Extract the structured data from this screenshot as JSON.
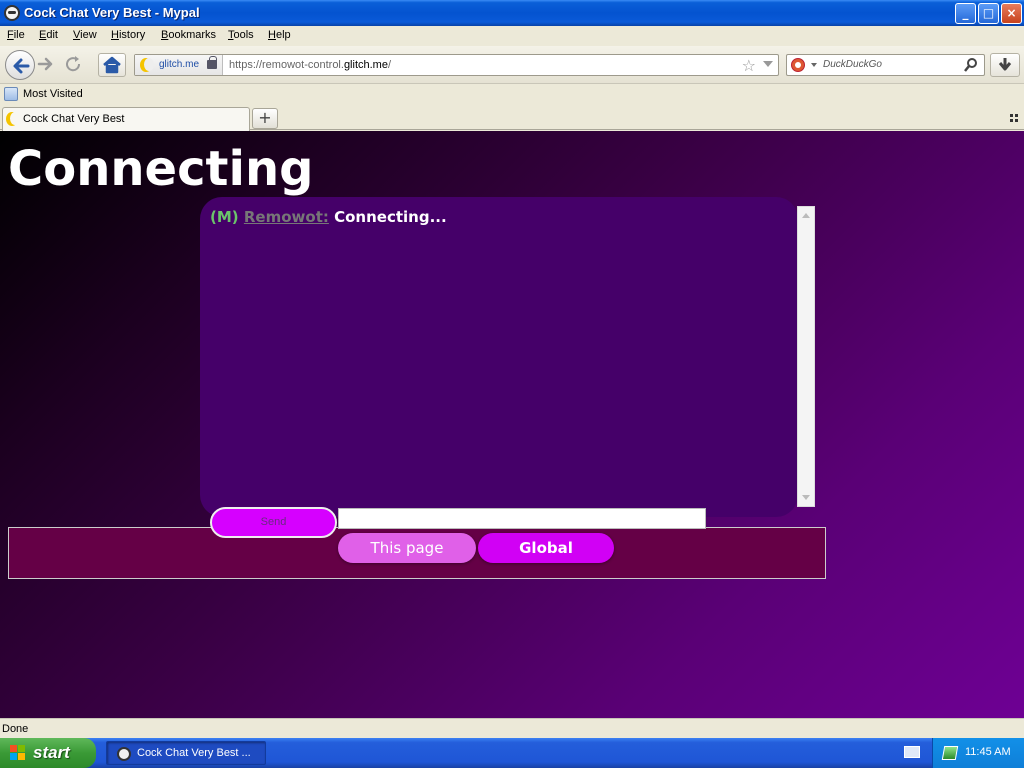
{
  "window": {
    "title": "Cock Chat Very Best - Mypal",
    "controls": {
      "minimize": "_",
      "maximize": "□",
      "close": "×"
    }
  },
  "menu": {
    "items": [
      {
        "label": "File",
        "accel": "F",
        "rest": "ile"
      },
      {
        "label": "Edit",
        "accel": "E",
        "rest": "dit"
      },
      {
        "label": "View",
        "accel": "V",
        "rest": "iew"
      },
      {
        "label": "History",
        "accel": "H",
        "rest": "istory"
      },
      {
        "label": "Bookmarks",
        "accel": "B",
        "rest": "ookmarks"
      },
      {
        "label": "Tools",
        "accel": "T",
        "rest": "ools"
      },
      {
        "label": "Help",
        "accel": "H",
        "rest": "elp"
      }
    ]
  },
  "navbar": {
    "identity_domain": "glitch.me",
    "url_prefix": "https://remowot-control.",
    "url_domain": "glitch.me",
    "url_suffix": "/",
    "search_placeholder": "DuckDuckGo"
  },
  "bookmarks": {
    "most_visited": "Most Visited"
  },
  "tabs": {
    "active_label": "Cock Chat Very Best",
    "new_tab": "+"
  },
  "page": {
    "heading": "Connecting",
    "message": {
      "tag": "(M)",
      "user": "Remowot:",
      "text": "Connecting..."
    },
    "send_label": "Send",
    "chat_input_value": "",
    "tab_this_page": "This page",
    "tab_global": "Global"
  },
  "status": {
    "text": "Done"
  },
  "taskbar": {
    "start_label": "start",
    "task_label": "Cock Chat Very Best ...",
    "clock": "11:45 AM"
  },
  "colors": {
    "chat_bg": "#450069",
    "panel_bg": "#650046",
    "accent": "#d600ff",
    "tag_green": "#6bc46b"
  }
}
